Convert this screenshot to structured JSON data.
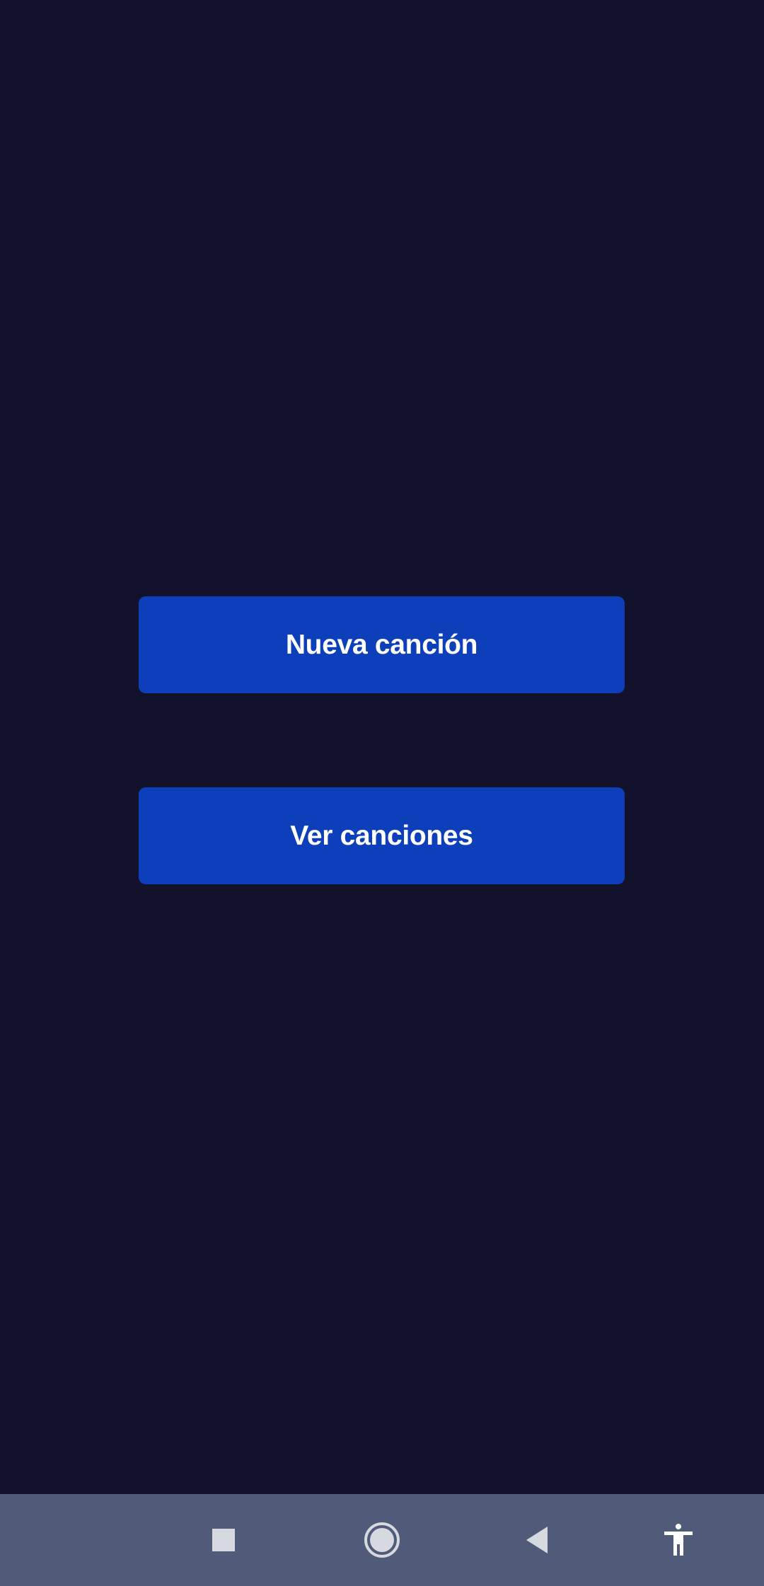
{
  "main": {
    "new_song_label": "Nueva canción",
    "view_songs_label": "Ver canciones"
  },
  "navbar": {
    "icons": [
      "recents-square-icon",
      "home-circle-icon",
      "back-triangle-icon",
      "accessibility-icon"
    ]
  },
  "colors": {
    "background": "#12122c",
    "button": "#0e3fbb",
    "button_text": "#ffffff",
    "navbar": "#4f5b78",
    "nav_icon": "#d6d9e0"
  }
}
